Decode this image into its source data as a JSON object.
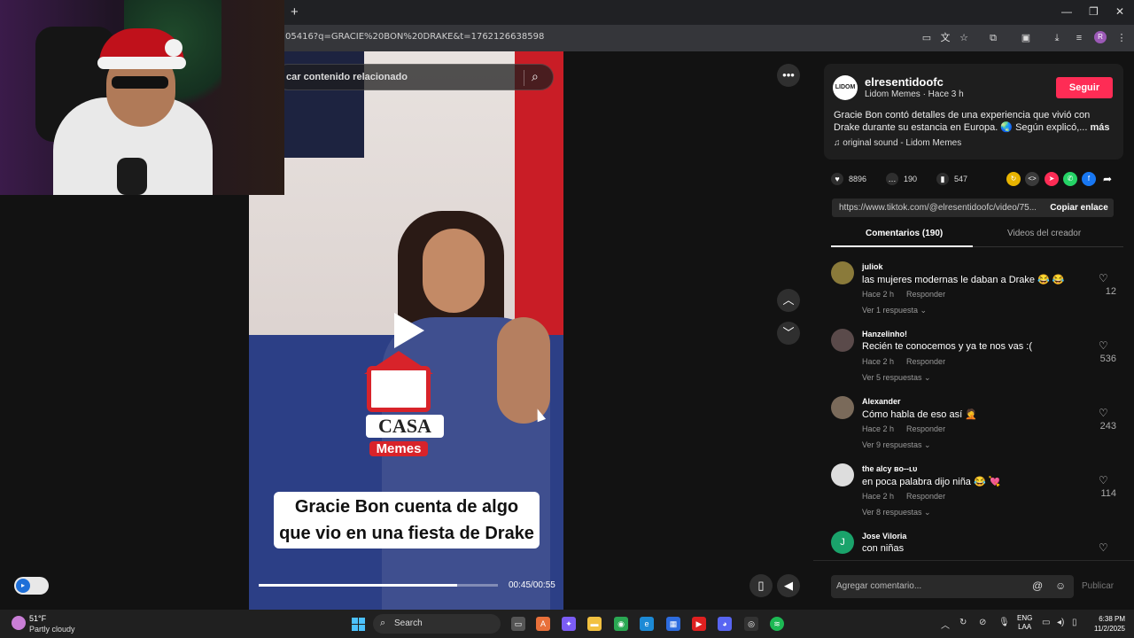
{
  "browser": {
    "new_tab_label": "+",
    "url": "05416?q=GRACIE%20BON%20DRAKE&t=1762126638598",
    "profile_initial": "R"
  },
  "search": {
    "placeholder": "car contenido relacionado"
  },
  "video": {
    "caption_line1": "Gracie Bon cuenta de algo",
    "caption_line2": "que vio en una fiesta de Drake",
    "logo_top": "CASA",
    "logo_bottom": "Memes",
    "time": "00:45/00:55",
    "progress": 0.83
  },
  "post": {
    "username": "elresentidoofc",
    "avatar_text": "LIDOM",
    "meta": "Lidom Memes · Hace 3 h",
    "follow_label": "Seguir",
    "description": "Gracie Bon contó detalles de una experiencia que vivió con Drake durante su estancia en Europa. 🌏 Según explicó,...",
    "more_label": "más",
    "sound": "♫  original sound - Lidom Memes",
    "likes": "8896",
    "comments": "190",
    "saves": "547",
    "link": "https://www.tiktok.com/@elresentidoofc/video/75...",
    "copy_label": "Copiar enlace"
  },
  "tabs": {
    "comments": "Comentarios (190)",
    "creator": "Videos del creador"
  },
  "comments": [
    {
      "user": "juliok",
      "text": "las mujeres modernas le daban a Drake 😂 😂",
      "time": "Hace 2 h",
      "reply": "Responder",
      "replies": "Ver 1 respuesta ⌄",
      "likes": "12",
      "avatar": "",
      "color": "#8a7a3a"
    },
    {
      "user": "Hanzelinho!",
      "text": "Recién te conocemos y ya te nos vas :(",
      "time": "Hace 2 h",
      "reply": "Responder",
      "replies": "Ver 5 respuestas ⌄",
      "likes": "536",
      "avatar": "",
      "color": "#5a4a4a"
    },
    {
      "user": "Alexander",
      "text": "Cómo habla de eso así 🤦",
      "time": "Hace 2 h",
      "reply": "Responder",
      "replies": "Ver 9 respuestas ⌄",
      "likes": "243",
      "avatar": "",
      "color": "#7a6a5a"
    },
    {
      "user": "the alcy ʙᴏ--ʟᴜ",
      "text": "en poca palabra dijo niña 😂 💘",
      "time": "Hace 2 h",
      "reply": "Responder",
      "replies": "Ver 8 respuestas ⌄",
      "likes": "114",
      "avatar": "",
      "color": "#ddd"
    },
    {
      "user": "Jose Viloria",
      "text": "con niñas",
      "time": "",
      "reply": "",
      "replies": "",
      "likes": "",
      "avatar": "J",
      "color": "#1aa36b"
    }
  ],
  "composer": {
    "placeholder": "Agregar comentario...",
    "publish": "Publicar"
  },
  "taskbar": {
    "temp": "51°F",
    "weather": "Partly cloudy",
    "search": "Search",
    "lang_line1": "ENG",
    "lang_line2": "LAA",
    "time": "6:38 PM",
    "date": "11/2/2025"
  },
  "colors": {
    "accent": "#fe2c55",
    "panel": "#121212"
  }
}
